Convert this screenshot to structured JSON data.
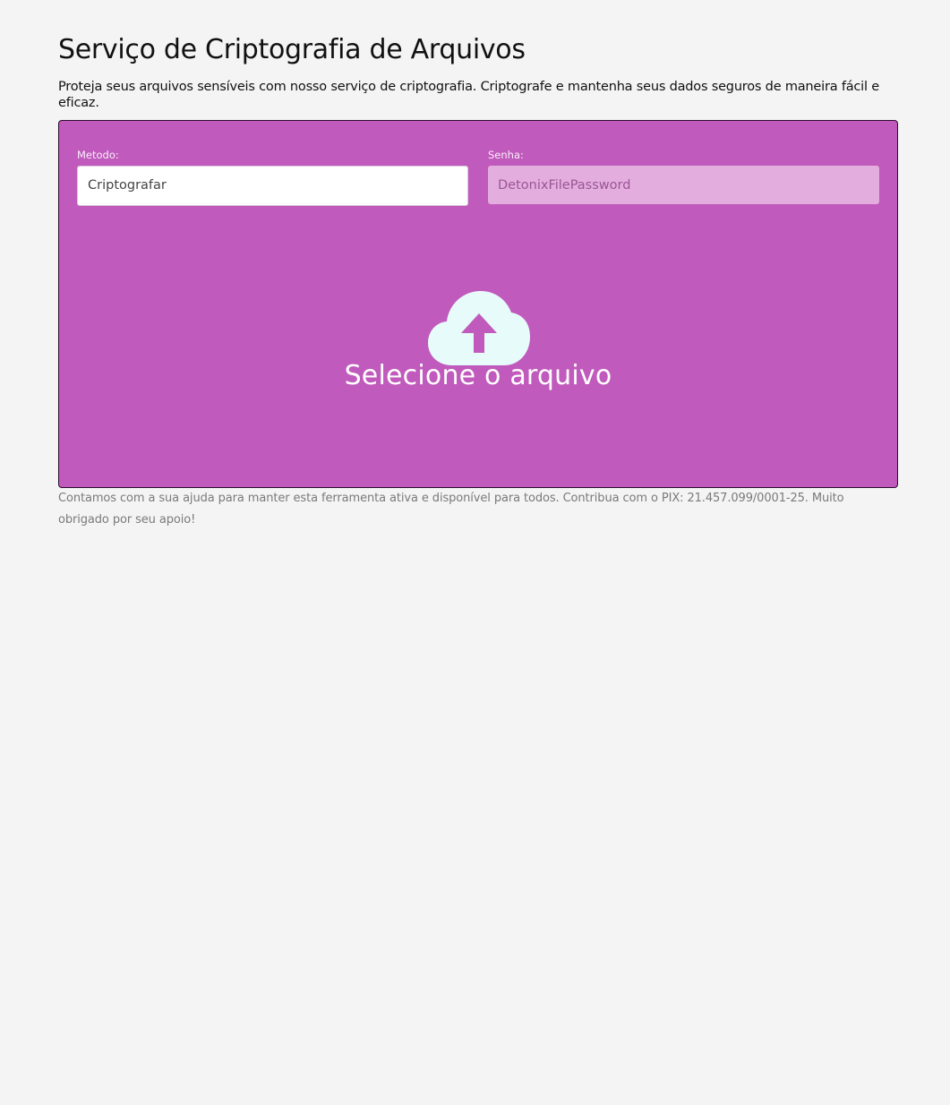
{
  "header": {
    "title": "Serviço de Criptografia de Arquivos",
    "subtitle": "Proteja seus arquivos sensíveis com nosso serviço de criptografia. Criptografe e mantenha seus dados seguros de maneira fácil e eficaz."
  },
  "form": {
    "method_label": "Metodo:",
    "method_value": "Criptografar",
    "password_label": "Senha:",
    "password_placeholder": "DetonixFilePassword",
    "password_value": ""
  },
  "dropzone": {
    "icon": "cloud-upload-icon",
    "label": "Selecione o arquivo"
  },
  "footer": {
    "note": "Contamos com a sua ajuda para manter esta ferramenta ativa e disponível para todos. Contribua com o PIX: 21.457.099/0001-25. Muito obrigado por seu apoio!"
  },
  "colors": {
    "page_background": "#f4f4f4",
    "panel_background": "#c05abc",
    "password_background": "#e3aede",
    "icon_color": "#e8fbfb",
    "arrow_color": "#c05abc"
  }
}
